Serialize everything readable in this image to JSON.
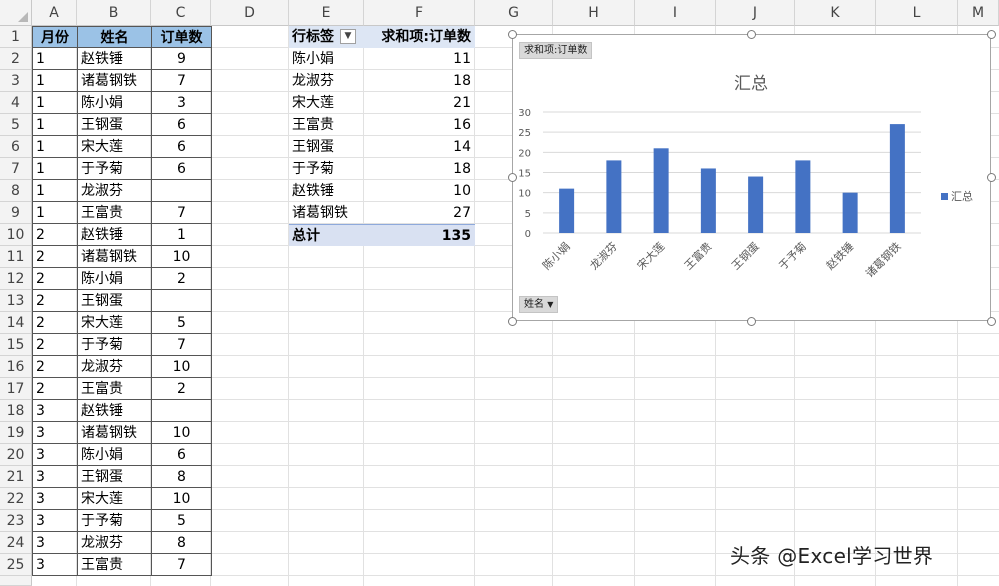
{
  "column_headers": [
    "A",
    "B",
    "C",
    "D",
    "E",
    "F",
    "G",
    "H",
    "I",
    "J",
    "K",
    "L",
    "M"
  ],
  "row_numbers": [
    "1",
    "2",
    "3",
    "4",
    "5",
    "6",
    "7",
    "8",
    "9",
    "10",
    "11",
    "12",
    "13",
    "14",
    "15",
    "16",
    "17",
    "18",
    "19",
    "20",
    "21",
    "22",
    "23",
    "24",
    "25"
  ],
  "table": {
    "headers": [
      "月份",
      "姓名",
      "订单数"
    ],
    "rows": [
      [
        "1",
        "赵铁锤",
        "9"
      ],
      [
        "1",
        "诸葛钢铁",
        "7"
      ],
      [
        "1",
        "陈小娟",
        "3"
      ],
      [
        "1",
        "王钢蛋",
        "6"
      ],
      [
        "1",
        "宋大莲",
        "6"
      ],
      [
        "1",
        "于予菊",
        "6"
      ],
      [
        "1",
        "龙淑芬",
        ""
      ],
      [
        "1",
        "王富贵",
        "7"
      ],
      [
        "2",
        "赵铁锤",
        "1"
      ],
      [
        "2",
        "诸葛钢铁",
        "10"
      ],
      [
        "2",
        "陈小娟",
        "2"
      ],
      [
        "2",
        "王钢蛋",
        ""
      ],
      [
        "2",
        "宋大莲",
        "5"
      ],
      [
        "2",
        "于予菊",
        "7"
      ],
      [
        "2",
        "龙淑芬",
        "10"
      ],
      [
        "2",
        "王富贵",
        "2"
      ],
      [
        "3",
        "赵铁锤",
        ""
      ],
      [
        "3",
        "诸葛钢铁",
        "10"
      ],
      [
        "3",
        "陈小娟",
        "6"
      ],
      [
        "3",
        "王钢蛋",
        "8"
      ],
      [
        "3",
        "宋大莲",
        "10"
      ],
      [
        "3",
        "于予菊",
        "5"
      ],
      [
        "3",
        "龙淑芬",
        "8"
      ],
      [
        "3",
        "王富贵",
        "7"
      ]
    ]
  },
  "pivot": {
    "row_label_header": "行标签",
    "value_header": "求和项:订单数",
    "rows": [
      [
        "陈小娟",
        "11"
      ],
      [
        "龙淑芬",
        "18"
      ],
      [
        "宋大莲",
        "21"
      ],
      [
        "王富贵",
        "16"
      ],
      [
        "王钢蛋",
        "14"
      ],
      [
        "于予菊",
        "18"
      ],
      [
        "赵铁锤",
        "10"
      ],
      [
        "诸葛钢铁",
        "27"
      ]
    ],
    "total_label": "总计",
    "total_value": "135"
  },
  "chart_data": {
    "type": "bar",
    "title": "汇总",
    "value_field_button": "求和项:订单数",
    "axis_field_button": "姓名",
    "categories": [
      "陈小娟",
      "龙淑芬",
      "宋大莲",
      "王富贵",
      "王钢蛋",
      "于予菊",
      "赵铁锤",
      "诸葛钢铁"
    ],
    "series": [
      {
        "name": "汇总",
        "values": [
          11,
          18,
          21,
          16,
          14,
          18,
          10,
          27
        ]
      }
    ],
    "ylim": [
      0,
      30
    ],
    "yticks": [
      0,
      5,
      10,
      15,
      20,
      25,
      30
    ],
    "grid": true,
    "legend": "right",
    "color": "#4472c4"
  },
  "watermark": "头条 @Excel学习世界",
  "colors": {
    "header_fill": "#9bc2e6",
    "pivot_header": "#dde6f4",
    "bar": "#4472c4"
  }
}
